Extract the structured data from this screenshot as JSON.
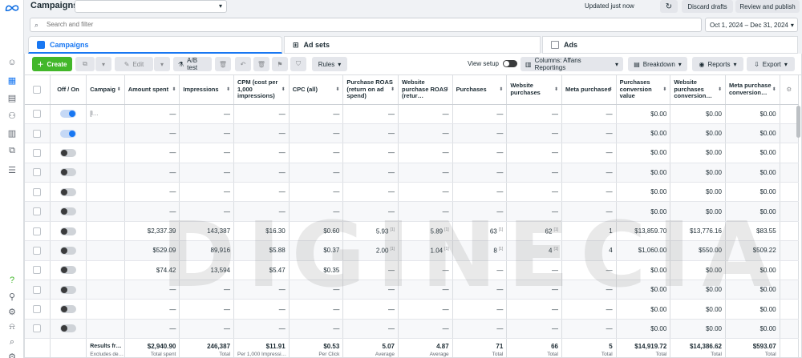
{
  "topbar": {
    "title": "Campaigns",
    "updated": "Updated just now",
    "discard": "Discard drafts",
    "review": "Review and publish",
    "more": "•••"
  },
  "search": {
    "placeholder": "Search and filter"
  },
  "date_range": "Oct 1, 2024 – Dec 31, 2024",
  "tabs": [
    {
      "label": "Campaigns"
    },
    {
      "label": "Ad sets"
    },
    {
      "label": "Ads"
    }
  ],
  "toolbar": {
    "create": "Create",
    "edit": "Edit",
    "ab_test": "A/B test",
    "rules": "Rules",
    "view_setup": "View setup",
    "columns": "Columns: Affans Reportings",
    "breakdown": "Breakdown",
    "reports": "Reports",
    "export": "Export"
  },
  "columns": [
    "Off / On",
    "Campaig",
    "Amount spent",
    "Impressions",
    "CPM (cost per 1,000 impressions)",
    "CPC (all)",
    "Purchase ROAS (return on ad spend)",
    "Website purchase ROAS (retur…",
    "Purchases",
    "Website purchases",
    "Meta purchases",
    "Purchases conversion value",
    "Website purchases conversion…",
    "Meta purchase conversion…"
  ],
  "rows": [
    {
      "on": true,
      "name": "[l…",
      "c": [
        "—",
        "—",
        "—",
        "—",
        "—",
        "—",
        "—",
        "—",
        "—",
        "$0.00",
        "$0.00",
        "$0.00"
      ]
    },
    {
      "on": true,
      "name": "",
      "c": [
        "—",
        "—",
        "—",
        "—",
        "—",
        "—",
        "—",
        "—",
        "—",
        "$0.00",
        "$0.00",
        "$0.00"
      ]
    },
    {
      "on": false,
      "name": "",
      "c": [
        "—",
        "—",
        "—",
        "—",
        "—",
        "—",
        "—",
        "—",
        "—",
        "$0.00",
        "$0.00",
        "$0.00"
      ]
    },
    {
      "on": false,
      "name": "",
      "c": [
        "—",
        "—",
        "—",
        "—",
        "—",
        "—",
        "—",
        "—",
        "—",
        "$0.00",
        "$0.00",
        "$0.00"
      ]
    },
    {
      "on": false,
      "name": "",
      "c": [
        "—",
        "—",
        "—",
        "—",
        "—",
        "—",
        "—",
        "—",
        "—",
        "$0.00",
        "$0.00",
        "$0.00"
      ]
    },
    {
      "on": false,
      "name": "",
      "c": [
        "—",
        "—",
        "—",
        "—",
        "—",
        "—",
        "—",
        "—",
        "—",
        "$0.00",
        "$0.00",
        "$0.00"
      ]
    },
    {
      "on": false,
      "name": "",
      "c": [
        "$2,337.39",
        "143,387",
        "$16.30",
        "$0.60",
        "5.93",
        "5.89",
        "63",
        "62",
        "1",
        "$13,859.70",
        "$13,776.16",
        "$83.55"
      ]
    },
    {
      "on": false,
      "name": "",
      "c": [
        "$529.09",
        "89,916",
        "$5.88",
        "$0.37",
        "2.00",
        "1.04",
        "8",
        "4",
        "4",
        "$1,060.00",
        "$550.00",
        "$509.22"
      ]
    },
    {
      "on": false,
      "name": "",
      "c": [
        "$74.42",
        "13,594",
        "$5.47",
        "$0.35",
        "—",
        "—",
        "—",
        "—",
        "—",
        "$0.00",
        "$0.00",
        "$0.00"
      ]
    },
    {
      "on": false,
      "name": "",
      "c": [
        "—",
        "—",
        "—",
        "—",
        "—",
        "—",
        "—",
        "—",
        "—",
        "$0.00",
        "$0.00",
        "$0.00"
      ]
    },
    {
      "on": false,
      "name": "",
      "c": [
        "—",
        "—",
        "—",
        "—",
        "—",
        "—",
        "—",
        "—",
        "—",
        "$0.00",
        "$0.00",
        "$0.00"
      ]
    },
    {
      "on": false,
      "name": "",
      "c": [
        "—",
        "—",
        "—",
        "—",
        "—",
        "—",
        "—",
        "—",
        "—",
        "$0.00",
        "$0.00",
        "$0.00"
      ]
    }
  ],
  "footnote_mark": "[1]",
  "footnote_cols": [
    4,
    5,
    6,
    7
  ],
  "totals": {
    "name": "Results fr…",
    "name_sub": "Excludes de…",
    "cells": [
      {
        "v": "$2,940.90",
        "s": "Total spent"
      },
      {
        "v": "246,387",
        "s": "Total"
      },
      {
        "v": "$11.91",
        "s": "Per 1,000 Impressi…"
      },
      {
        "v": "$0.53",
        "s": "Per Click"
      },
      {
        "v": "5.07",
        "s": "Average"
      },
      {
        "v": "4.87",
        "s": "Average"
      },
      {
        "v": "71",
        "s": "Total"
      },
      {
        "v": "66",
        "s": "Total"
      },
      {
        "v": "5",
        "s": "Total"
      },
      {
        "v": "$14,919.72",
        "s": "Total"
      },
      {
        "v": "$14,386.62",
        "s": "Total"
      },
      {
        "v": "$593.07",
        "s": "Total"
      }
    ]
  },
  "watermark": "DIGINECIA",
  "colors": {
    "accent": "#1877f2",
    "create": "#42b72a"
  }
}
